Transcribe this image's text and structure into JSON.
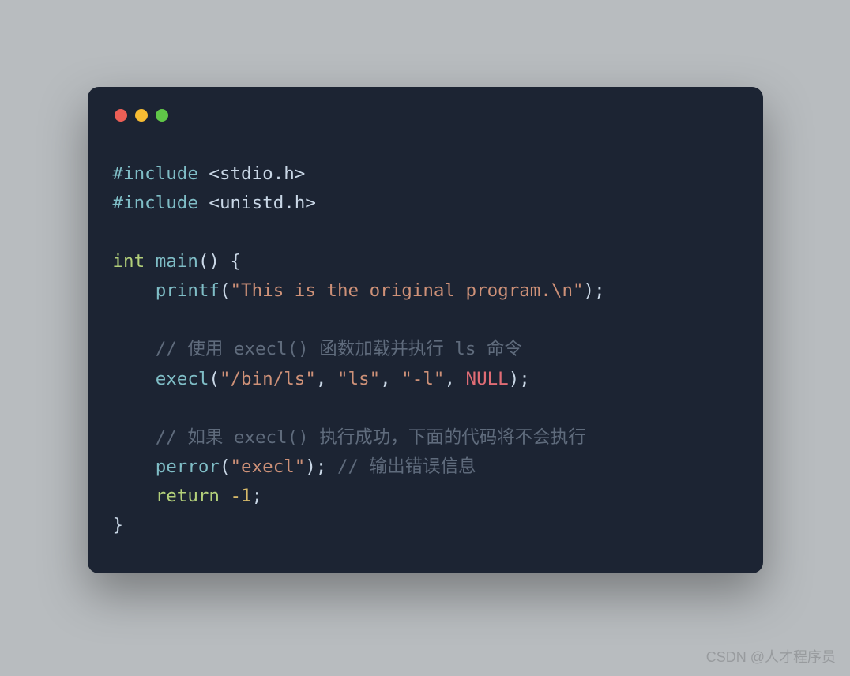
{
  "colors": {
    "bg_page": "#b8bcbf",
    "bg_window": "#1c2433",
    "dot_red": "#ec5f56",
    "dot_yellow": "#f6bc33",
    "dot_green": "#60c748",
    "preprocessor": "#7fbdc6",
    "keyword": "#b3d07a",
    "function": "#7fbdc6",
    "string": "#ce9178",
    "null_kw": "#e06c75",
    "number": "#d7ba6a",
    "comment": "#5f6b7c",
    "text": "#c9d7e6"
  },
  "code": {
    "line1": {
      "prep": "#include",
      "sp": " ",
      "hdr": "<stdio.h>"
    },
    "line2": {
      "prep": "#include",
      "sp": " ",
      "hdr": "<unistd.h>"
    },
    "line3": "",
    "line4": {
      "kw": "int",
      "sp1": " ",
      "fn": "main",
      "rest": "() {"
    },
    "line5": {
      "indent": "    ",
      "fn": "printf",
      "p1": "(",
      "str": "\"This is the original program.\\n\"",
      "p2": ");"
    },
    "line6": "",
    "line7": {
      "indent": "    ",
      "cm": "// 使用 execl() 函数加载并执行 ls 命令"
    },
    "line8": {
      "indent": "    ",
      "fn": "execl",
      "p1": "(",
      "s1": "\"/bin/ls\"",
      "c1": ", ",
      "s2": "\"ls\"",
      "c2": ", ",
      "s3": "\"-l\"",
      "c3": ", ",
      "nul": "NULL",
      "p2": ");"
    },
    "line9": "",
    "line10": {
      "indent": "    ",
      "cm": "// 如果 execl() 执行成功，下面的代码将不会执行"
    },
    "line11": {
      "indent": "    ",
      "fn": "perror",
      "p1": "(",
      "str": "\"execl\"",
      "p2": "); ",
      "cm": "// 输出错误信息"
    },
    "line12": {
      "indent": "    ",
      "kw": "return",
      "sp": " ",
      "num": "-1",
      "sc": ";"
    },
    "line13": {
      "brace": "}"
    }
  },
  "watermark": "CSDN @人才程序员"
}
